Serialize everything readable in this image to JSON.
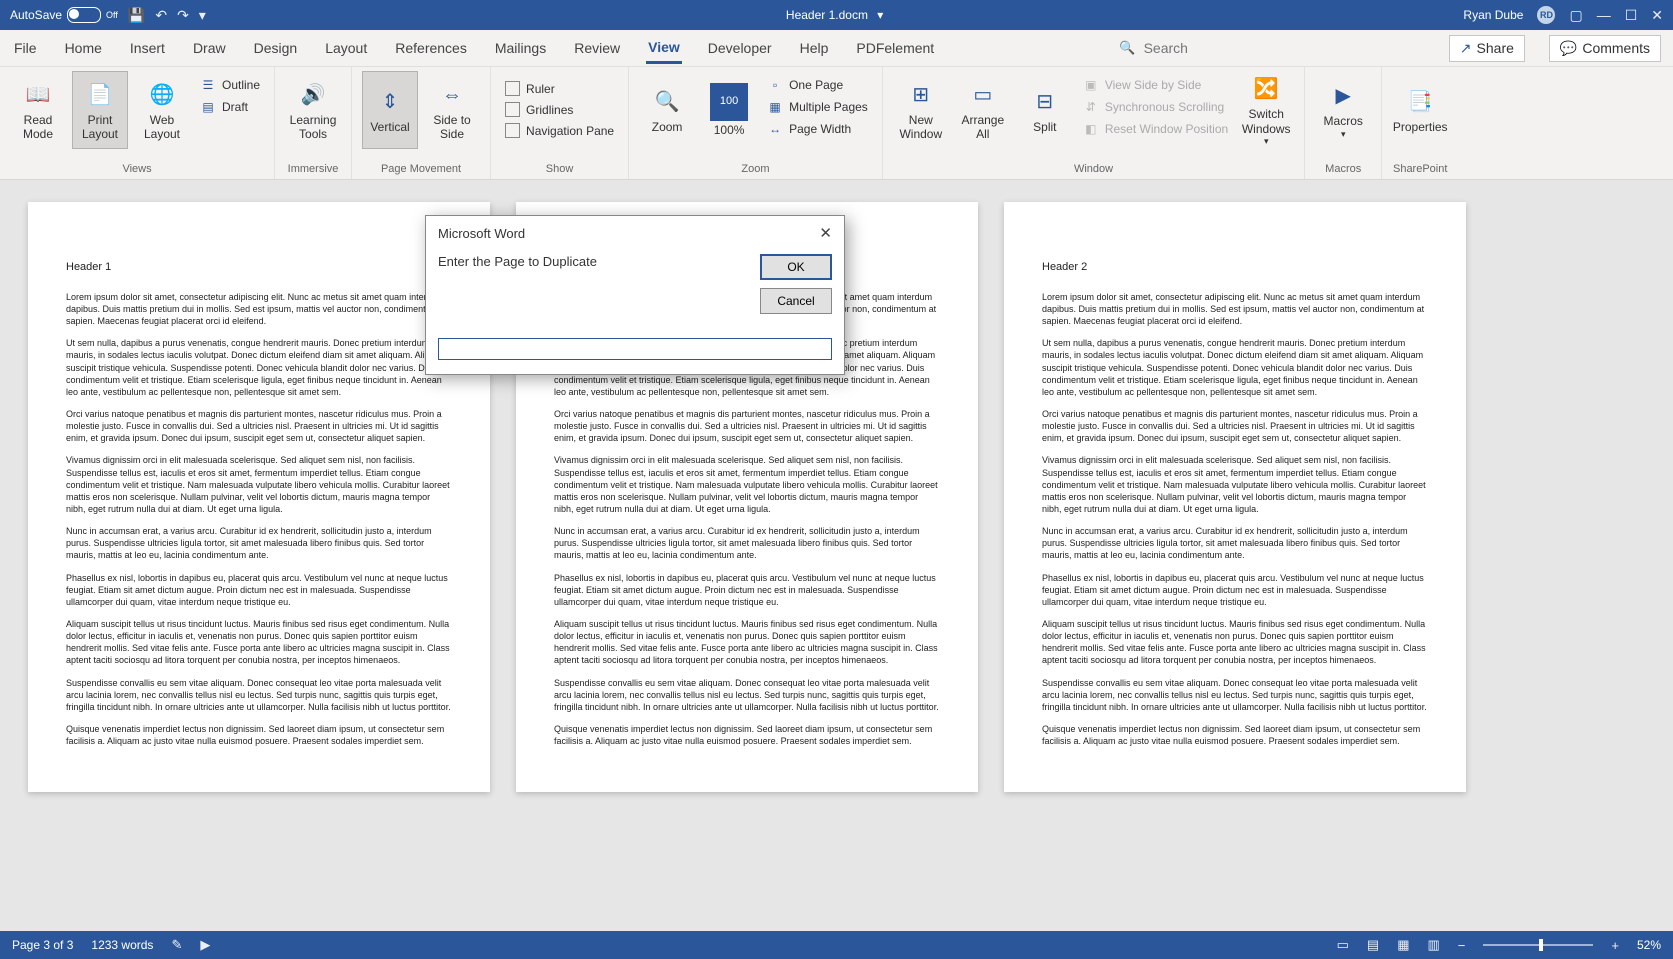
{
  "titlebar": {
    "autosave_label": "AutoSave",
    "autosave_state": "Off",
    "doc_title": "Header 1.docm",
    "user_name": "Ryan Dube",
    "user_initials": "RD"
  },
  "tabs": {
    "items": [
      "File",
      "Home",
      "Insert",
      "Draw",
      "Design",
      "Layout",
      "References",
      "Mailings",
      "Review",
      "View",
      "Developer",
      "Help",
      "PDFelement"
    ],
    "active": "View",
    "search_placeholder": "Search",
    "share": "Share",
    "comments": "Comments"
  },
  "ribbon": {
    "views": {
      "label": "Views",
      "read_mode": "Read Mode",
      "print_layout": "Print Layout",
      "web_layout": "Web Layout",
      "outline": "Outline",
      "draft": "Draft"
    },
    "immersive": {
      "label": "Immersive",
      "learning_tools": "Learning Tools"
    },
    "page_movement": {
      "label": "Page Movement",
      "vertical": "Vertical",
      "side": "Side to Side"
    },
    "show": {
      "label": "Show",
      "ruler": "Ruler",
      "gridlines": "Gridlines",
      "nav": "Navigation Pane"
    },
    "zoom_group": {
      "label": "Zoom",
      "zoom": "Zoom",
      "hundred": "100%",
      "one_page": "One Page",
      "multi": "Multiple Pages",
      "page_width": "Page Width"
    },
    "window_group": {
      "label": "Window",
      "new_win": "New Window",
      "arrange": "Arrange All",
      "split": "Split",
      "side_by_side": "View Side by Side",
      "sync": "Synchronous Scrolling",
      "reset": "Reset Window Position",
      "switch": "Switch Windows"
    },
    "macros": {
      "label": "Macros",
      "btn": "Macros"
    },
    "sharepoint": {
      "label": "SharePoint",
      "btn": "Properties"
    }
  },
  "dialog": {
    "title": "Microsoft Word",
    "prompt": "Enter the Page to Duplicate",
    "ok": "OK",
    "cancel": "Cancel",
    "value": ""
  },
  "document": {
    "h1": "Header 1",
    "h2": "Header 2",
    "p1": "Lorem ipsum dolor sit amet, consectetur adipiscing elit. Nunc ac metus sit amet quam interdum dapibus. Duis mattis pretium dui in mollis. Sed est ipsum, mattis vel auctor non, condimentum at sapien. Maecenas feugiat placerat orci id eleifend.",
    "p2": "Ut sem nulla, dapibus a purus venenatis, congue hendrerit mauris. Donec pretium interdum mauris, in sodales lectus iaculis volutpat. Donec dictum eleifend diam sit amet aliquam. Aliquam suscipit tristique vehicula. Suspendisse potenti. Donec vehicula blandit dolor nec varius. Duis condimentum velit et tristique. Etiam scelerisque ligula, eget finibus neque tincidunt in. Aenean leo ante, vestibulum ac pellentesque non, pellentesque sit amet sem.",
    "p3": "Orci varius natoque penatibus et magnis dis parturient montes, nascetur ridiculus mus. Proin a molestie justo. Fusce in convallis dui. Sed a ultricies nisl. Praesent in ultricies mi. Ut id sagittis enim, et gravida ipsum. Donec dui ipsum, suscipit eget sem ut, consectetur aliquet sapien.",
    "p4": "Vivamus dignissim orci in elit malesuada scelerisque. Sed aliquet sem nisl, non facilisis. Suspendisse tellus est, iaculis et eros sit amet, fermentum imperdiet tellus. Etiam congue condimentum velit et tristique. Nam malesuada vulputate libero vehicula mollis. Curabitur laoreet mattis eros non scelerisque. Nullam pulvinar, velit vel lobortis dictum, mauris magna tempor nibh, eget rutrum nulla dui at diam. Ut eget urna ligula.",
    "p5": "Nunc in accumsan erat, a varius arcu. Curabitur id ex hendrerit, sollicitudin justo a, interdum purus. Suspendisse ultricies ligula tortor, sit amet malesuada libero finibus quis. Sed tortor mauris, mattis at leo eu, lacinia condimentum ante.",
    "p6": "Phasellus ex nisl, lobortis in dapibus eu, placerat quis arcu. Vestibulum vel nunc at neque luctus feugiat. Etiam sit amet dictum augue. Proin dictum nec est in malesuada. Suspendisse ullamcorper dui quam, vitae interdum neque tristique eu.",
    "p7": "Aliquam suscipit tellus ut risus tincidunt luctus. Mauris finibus sed risus eget condimentum. Nulla dolor lectus, efficitur in iaculis et, venenatis non purus. Donec quis sapien porttitor euism hendrerit mollis. Sed vitae felis ante. Fusce porta ante libero ac ultricies magna suscipit in. Class aptent taciti sociosqu ad litora torquent per conubia nostra, per inceptos himenaeos.",
    "p8": "Suspendisse convallis eu sem vitae aliquam. Donec consequat leo vitae porta malesuada velit arcu lacinia lorem, nec convallis tellus nisl eu lectus. Sed turpis nunc, sagittis quis turpis eget, fringilla tincidunt nibh. In ornare ultricies ante ut ullamcorper. Nulla facilisis nibh ut luctus porttitor.",
    "p9": "Quisque venenatis imperdiet lectus non dignissim. Sed laoreet diam ipsum, ut consectetur sem facilisis a. Aliquam ac justo vitae nulla euismod posuere. Praesent sodales imperdiet sem."
  },
  "status": {
    "page": "Page 3 of 3",
    "words": "1233 words",
    "zoom": "52%"
  }
}
